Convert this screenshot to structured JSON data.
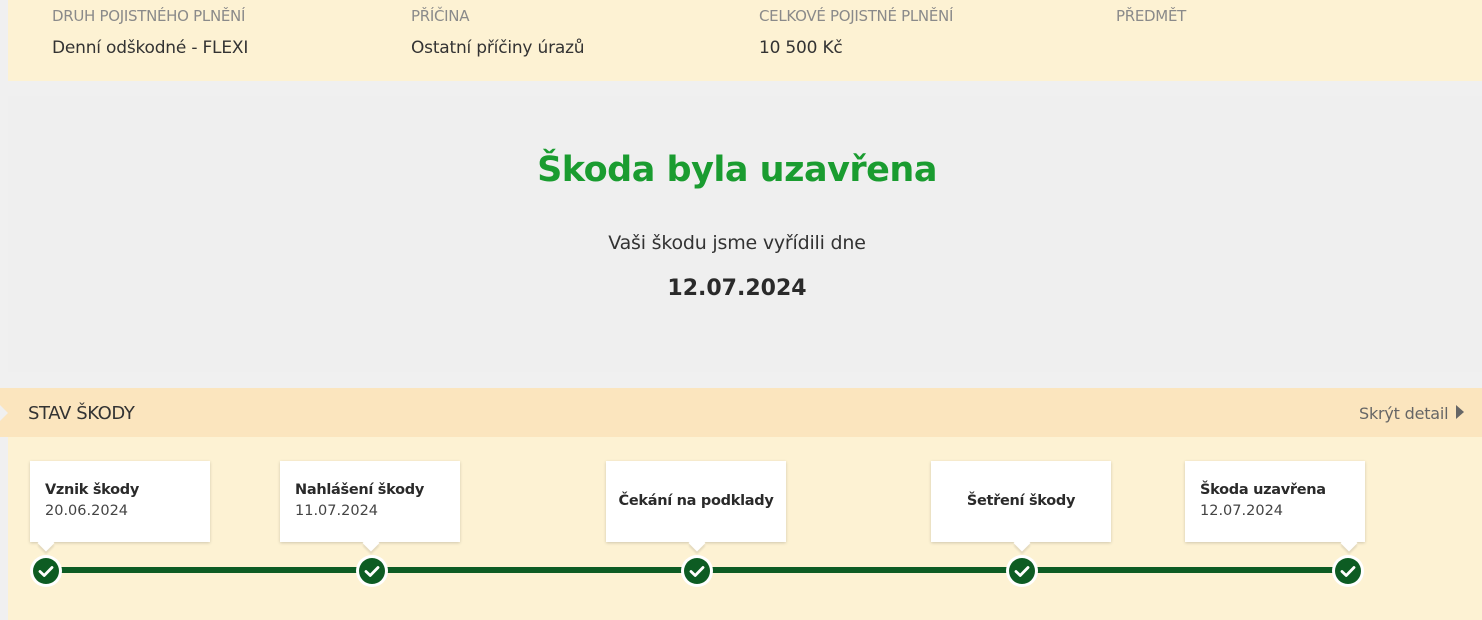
{
  "claim_info": {
    "columns": [
      {
        "label": "DRUH POJISTNÉHO PLNĚNÍ",
        "value": "Denní odškodné - FLEXI"
      },
      {
        "label": "PŘÍČINA",
        "value": "Ostatní příčiny úrazů"
      },
      {
        "label": "CELKOVÉ POJISTNÉ PLNĚNÍ",
        "value": "10 500 Kč"
      },
      {
        "label": "PŘEDMĚT",
        "value": ""
      }
    ]
  },
  "closed_notice": {
    "title": "Škoda byla uzavřena",
    "subtitle": "Vaši škodu jsme vyřídili dne",
    "date": "12.07.2024"
  },
  "status": {
    "title": "STAV ŠKODY",
    "toggle_label": "Skrýt detail",
    "steps": [
      {
        "name": "Vznik škody",
        "date": "20.06.2024",
        "done": true
      },
      {
        "name": "Nahlášení škody",
        "date": "11.07.2024",
        "done": true
      },
      {
        "name": "Čekání na podklady",
        "date": "",
        "done": true
      },
      {
        "name": "Šetření škody",
        "date": "",
        "done": true
      },
      {
        "name": "Škoda uzavřena",
        "date": "12.07.2024",
        "done": true
      }
    ]
  },
  "colors": {
    "accent_green": "#1a9c30",
    "timeline_green": "#0d5c23",
    "info_background": "#fdf2d3",
    "header_background": "#fbe5be"
  }
}
